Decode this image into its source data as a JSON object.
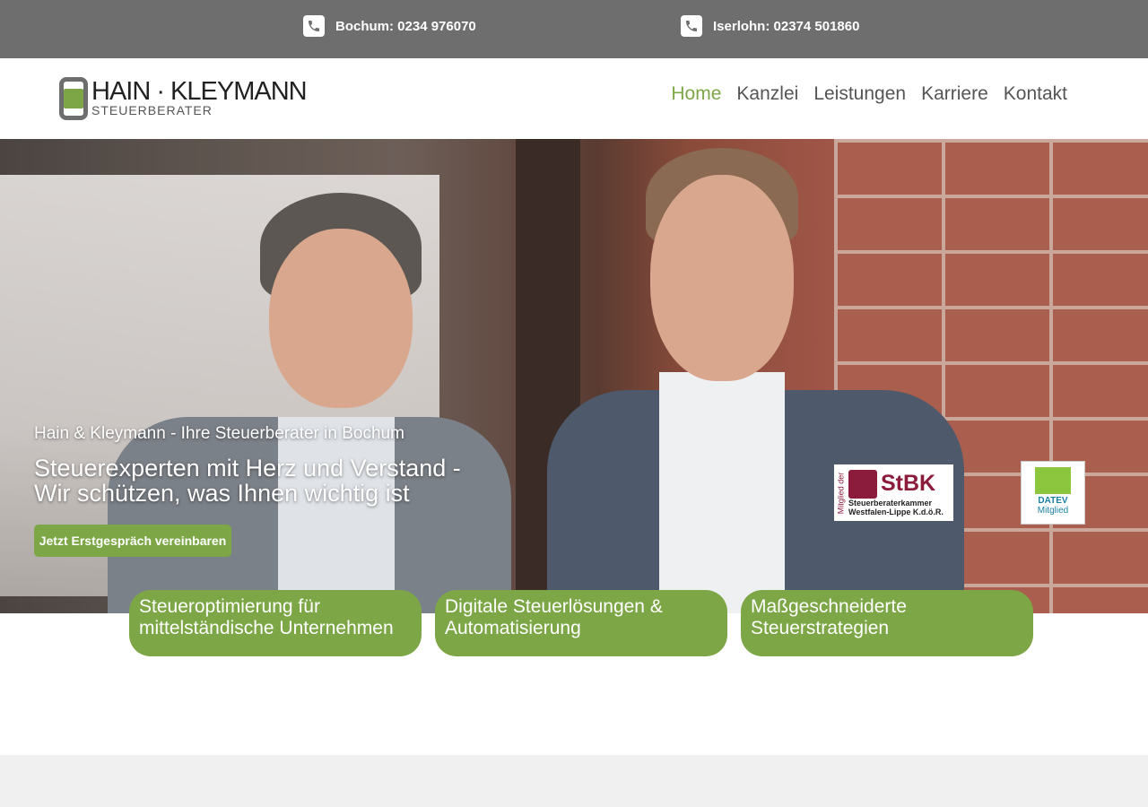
{
  "topbar": {
    "bochum_label": "Bochum: 0234 976070",
    "iserlohn_label": "Iserlohn: 02374 501860",
    "icon": "phone-icon",
    "background": "#6e6e6e"
  },
  "logo": {
    "name": "HAIN · KLEYMANN",
    "subtitle": "STEUERBERATER",
    "accent": "#7da746"
  },
  "nav": {
    "items": [
      {
        "label": "Home",
        "active": true
      },
      {
        "label": "Kanzlei",
        "active": false
      },
      {
        "label": "Leistungen",
        "active": false
      },
      {
        "label": "Karriere",
        "active": false
      },
      {
        "label": "Kontakt",
        "active": false
      }
    ]
  },
  "hero": {
    "subheading": "Hain & Kleymann - Ihre Steuerberater in Bochum",
    "title": "Steuerexperten mit Herz und Verstand - Wir schützen, was Ihnen wichtig ist",
    "cta_label": "Jetzt Erstgespräch vereinbaren"
  },
  "badges": {
    "stbk": {
      "side_text": "Mitglied der",
      "abbr": "StBK",
      "line1": "Steuerberaterkammer",
      "line2": "Westfalen-Lippe K.d.ö.R."
    },
    "datev": {
      "name": "DATEV",
      "member": "Mitglied"
    }
  },
  "services": [
    {
      "label": "Steueroptimierung für mittelständische Unternehmen"
    },
    {
      "label": "Digitale Steuerlösungen & Automatisierung"
    },
    {
      "label": "Maßgeschneiderte Steuerstrategien"
    }
  ]
}
